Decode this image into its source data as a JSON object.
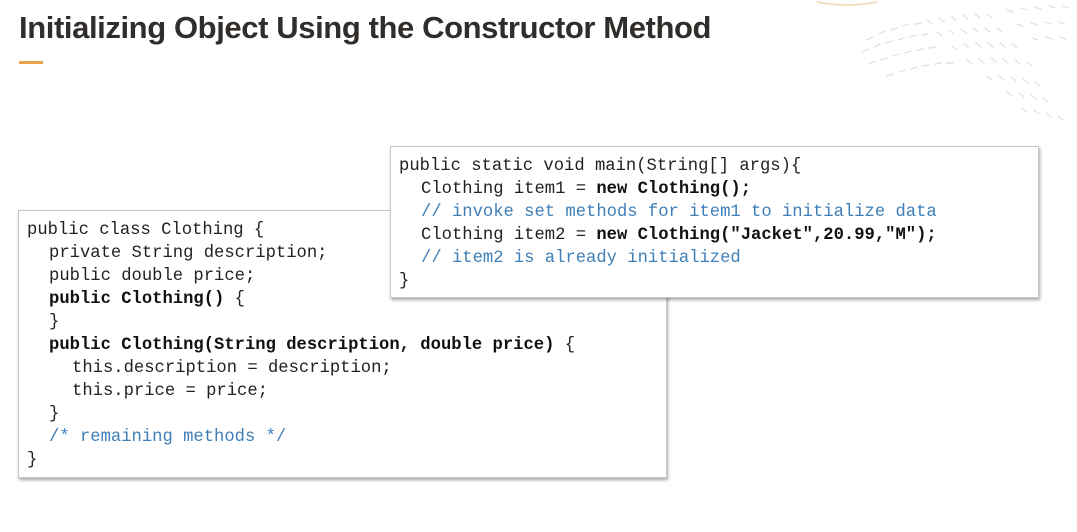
{
  "slide": {
    "title": "Initializing Object Using the Constructor Method"
  },
  "class_code": {
    "l1": "public class Clothing {",
    "l2": "private String description;",
    "l3": "public double price;",
    "l4a": "public Clothing()",
    "l4b": " {",
    "l5": "}",
    "l6a": "public Clothing(String description, double price)",
    "l6b": " {",
    "l7": "this.description = description;",
    "l8": "this.price = price;",
    "l9": "}",
    "l10": "/* remaining methods */",
    "l11": "}"
  },
  "main_code": {
    "l1": "public static void main(String[] args){",
    "l2a": "Clothing item1 = ",
    "l2b": "new Clothing();",
    "l3": "// invoke set methods for item1 to initialize data",
    "l4a": "Clothing item2 = ",
    "l4b": "new Clothing(\"Jacket\",20.99,\"M\");",
    "l5": "// item2 is already initialized",
    "l6": "}"
  },
  "colors": {
    "accent": "#e7a34d",
    "comment": "#3f7fb8",
    "title": "#312d2a"
  }
}
